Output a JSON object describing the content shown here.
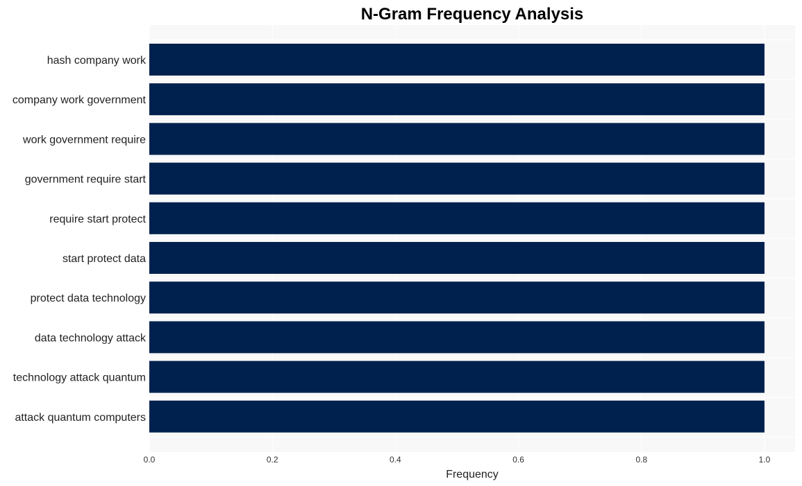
{
  "chart_data": {
    "type": "bar",
    "orientation": "horizontal",
    "title": "N-Gram Frequency Analysis",
    "xlabel": "Frequency",
    "ylabel": "",
    "categories": [
      "hash company work",
      "company work government",
      "work government require",
      "government require start",
      "require start protect",
      "start protect data",
      "protect data technology",
      "data technology attack",
      "technology attack quantum",
      "attack quantum computers"
    ],
    "values": [
      1,
      1,
      1,
      1,
      1,
      1,
      1,
      1,
      1,
      1
    ],
    "xlim": [
      0,
      1.05
    ],
    "xticks": [
      "0.0",
      "0.2",
      "0.4",
      "0.6",
      "0.8",
      "1.0"
    ],
    "grid": true,
    "legend": "none",
    "colors": {
      "bar": "#00214e",
      "plot_bg": "#f8f8f8",
      "grid": "#ffffff"
    }
  }
}
